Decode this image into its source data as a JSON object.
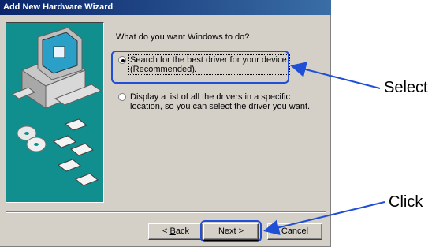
{
  "window": {
    "title": "Add New Hardware Wizard"
  },
  "main": {
    "prompt": "What do you want Windows to do?",
    "options": [
      {
        "line1": "Search for the best driver for your device.",
        "line2": "(Recommended).",
        "selected": true
      },
      {
        "line1": "Display a list of all the drivers in a specific",
        "line2": "location, so you can select the driver you want.",
        "selected": false
      }
    ]
  },
  "buttons": {
    "back": {
      "mnemonic": "B",
      "rest": "ack"
    },
    "next": "Next >",
    "cancel": "Cancel"
  },
  "annotations": {
    "select": "Select",
    "click": "Click",
    "color": "#1f4fd6"
  },
  "art": {
    "background": "#118f8f",
    "icons": [
      "computer-icon",
      "cd-icon",
      "floppy-disk-icon"
    ]
  }
}
